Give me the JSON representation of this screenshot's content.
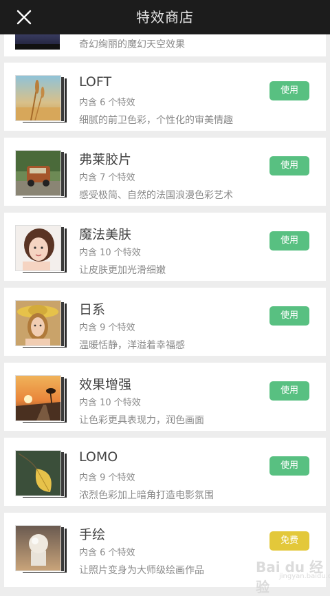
{
  "header": {
    "title": "特效商店",
    "close_icon": "close-icon"
  },
  "partial_item": {
    "desc": "奇幻绚丽的魔幻天空效果"
  },
  "items": [
    {
      "name": "LOFT",
      "count": "内含 6 个特效",
      "desc": "细腻的前卫色彩，个性化的审美情趣",
      "button": "使用",
      "button_type": "use",
      "thumb_icon": "wheat-photo"
    },
    {
      "name": "弗莱胶片",
      "count": "内含 7 个特效",
      "desc": "感受极简、自然的法国浪漫色彩艺术",
      "button": "使用",
      "button_type": "use",
      "thumb_icon": "vintage-car-photo"
    },
    {
      "name": "魔法美肤",
      "count": "内含 10 个特效",
      "desc": "让皮肤更加光滑细嫩",
      "button": "使用",
      "button_type": "use",
      "thumb_icon": "portrait-photo"
    },
    {
      "name": "日系",
      "count": "内含 9 个特效",
      "desc": "温暖恬静，洋溢着幸福感",
      "button": "使用",
      "button_type": "use",
      "thumb_icon": "hat-girl-photo"
    },
    {
      "name": "效果增强",
      "count": "内含 10 个特效",
      "desc": "让色彩更具表现力，润色画面",
      "button": "使用",
      "button_type": "use",
      "thumb_icon": "sunset-road-photo"
    },
    {
      "name": "LOMO",
      "count": "内含 9 个特效",
      "desc": "浓烈色彩加上暗角打造电影氛围",
      "button": "使用",
      "button_type": "use",
      "thumb_icon": "leaf-photo"
    },
    {
      "name": "手绘",
      "count": "内含 6 个特效",
      "desc": "让照片变身为大师级绘画作品",
      "button": "免费",
      "button_type": "free",
      "thumb_icon": "sphere-sketch-photo"
    }
  ],
  "watermark": {
    "main": "Bai du 经验",
    "sub": "jingyan.baidu.com"
  },
  "colors": {
    "header_bg": "#1c1c1c",
    "use_button": "#58c081",
    "free_button": "#e3c83a",
    "page_bg": "#ededed"
  }
}
